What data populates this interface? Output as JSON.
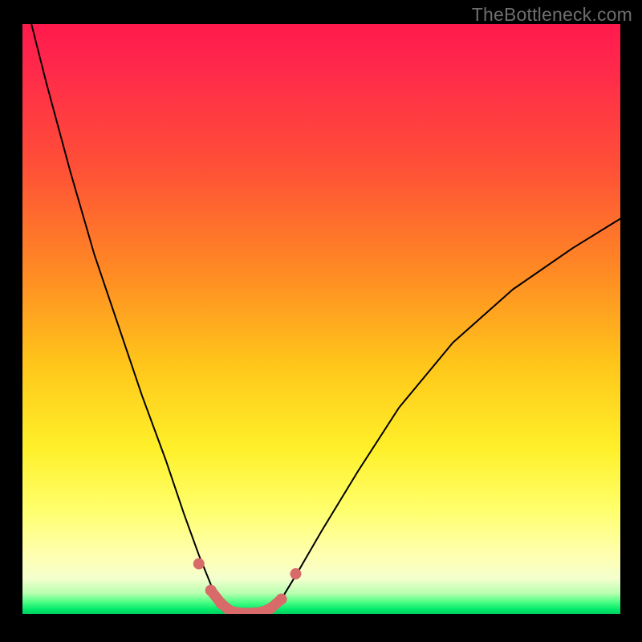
{
  "watermark": "TheBottleneck.com",
  "chart_data": {
    "type": "line",
    "title": "",
    "xlabel": "",
    "ylabel": "",
    "xlim": [
      0,
      100
    ],
    "ylim": [
      0,
      100
    ],
    "grid": false,
    "background_gradient": {
      "direction": "vertical",
      "stops": [
        {
          "pos": 0,
          "color": "#ff1a4d"
        },
        {
          "pos": 25,
          "color": "#ff5236"
        },
        {
          "pos": 50,
          "color": "#ffb01e"
        },
        {
          "pos": 72,
          "color": "#fff02a"
        },
        {
          "pos": 90,
          "color": "#ffffb0"
        },
        {
          "pos": 97,
          "color": "#80ff9a"
        },
        {
          "pos": 100,
          "color": "#00d060"
        }
      ]
    },
    "series": [
      {
        "name": "black-curve-left",
        "color": "#000000",
        "stroke_width": 2,
        "x": [
          1.5,
          4,
          8,
          12,
          16,
          20,
          24,
          27,
          29.5,
          31.5,
          33,
          34.5
        ],
        "y": [
          100,
          90,
          75,
          61,
          49,
          37,
          26,
          17,
          10,
          5,
          1,
          0
        ]
      },
      {
        "name": "black-curve-right",
        "color": "#000000",
        "stroke_width": 2,
        "x": [
          41,
          43,
          46,
          50,
          56,
          63,
          72,
          82,
          92,
          100
        ],
        "y": [
          0,
          2,
          7,
          14,
          24,
          35,
          46,
          55,
          62,
          67
        ]
      },
      {
        "name": "salmon-markers",
        "color": "#d86a6a",
        "marker": "circle",
        "marker_radius_px": 7,
        "x": [
          29.5,
          31.5,
          33.2,
          34.6,
          35.9,
          37.3,
          38.6,
          40.0,
          41.6,
          43.3,
          45.7
        ],
        "y": [
          8.5,
          4.0,
          1.8,
          0.6,
          0.2,
          0.1,
          0.15,
          0.3,
          1.0,
          2.5,
          6.8
        ]
      },
      {
        "name": "salmon-connector",
        "color": "#d86a6a",
        "stroke_width": 13,
        "x": [
          31.5,
          33.2,
          34.6,
          35.9,
          37.3,
          38.6,
          40.0,
          41.6,
          43.3
        ],
        "y": [
          4.0,
          1.8,
          0.6,
          0.2,
          0.1,
          0.15,
          0.3,
          1.0,
          2.5
        ]
      }
    ]
  }
}
